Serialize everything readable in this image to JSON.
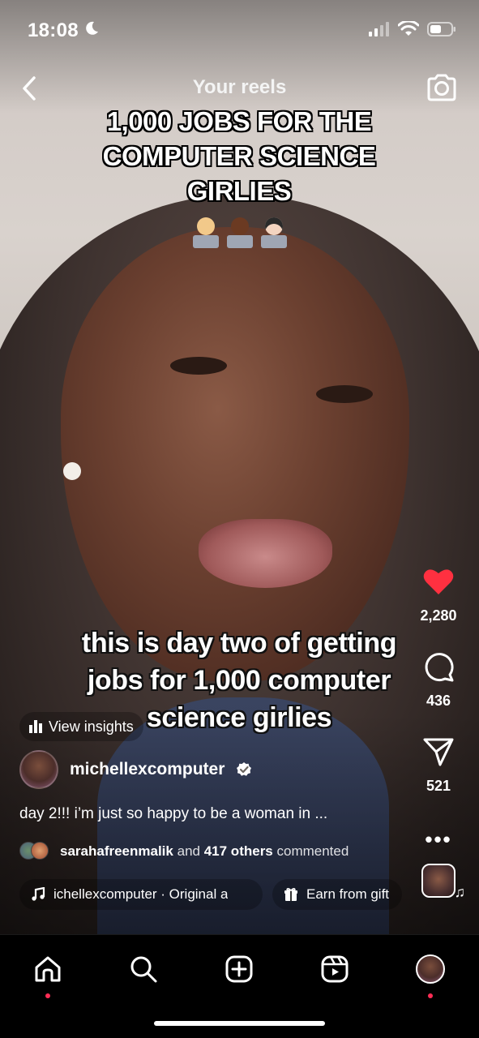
{
  "status_bar": {
    "time": "18:08"
  },
  "header": {
    "title": "Your reels"
  },
  "overlay": {
    "top_lines": [
      "1,000 JOBS FOR THE",
      "COMPUTER SCIENCE",
      "GIRLIES"
    ],
    "emoji_count": 3,
    "mid_lines": [
      "this is day two of getting",
      "jobs for 1,000 computer",
      "science girlies"
    ]
  },
  "actions": {
    "likes": "2,280",
    "comments": "436",
    "shares": "521"
  },
  "post": {
    "insights_label": "View insights",
    "username": "michellexcomputer",
    "description": "day 2!!! i’m just so happy to be a woman in ...",
    "commenter": "sarahafreenmalik",
    "comments_and": "and",
    "comments_others": "417 others",
    "comments_suffix": "commented"
  },
  "chips": {
    "music": "ichellexcomputer · Original a",
    "gift": "Earn from gift"
  },
  "colors": {
    "like": "#ff3040",
    "notification_dot": "#ff2d55"
  },
  "tabs": [
    "home-icon",
    "search-icon",
    "create-icon",
    "reels-icon",
    "profile-avatar"
  ]
}
